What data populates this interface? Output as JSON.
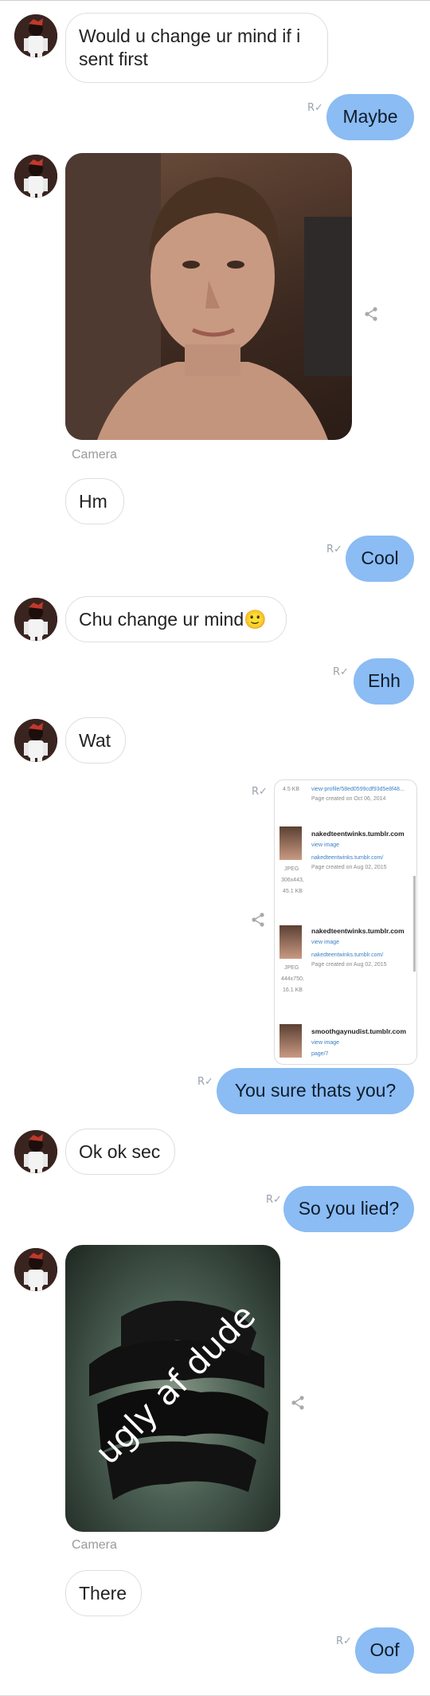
{
  "messages": {
    "m1": "Would u change ur mind if i sent first",
    "m2": "Maybe",
    "photo1_caption": "Camera",
    "m3": "Hm",
    "m4": "Cool",
    "m5": "Chu change ur mind",
    "m5_emoji": "🙂",
    "m6": "Ehh",
    "m7": "Wat",
    "m8": "You sure thats you?",
    "m9": "Ok ok sec",
    "m10": "So you lied?",
    "photo2_caption": "Camera",
    "photo2_overlay": "ugly af dude",
    "m11": "There",
    "m12": "Oof"
  },
  "receipt_icon": "R✓",
  "screenshot": {
    "top_size": "4.5 KB",
    "top_link": "view-profile/58ed0599cdf93d5e8f48...",
    "top_created": "Page created on Oct 06, 2014",
    "r1_site": "nakedteentwinks.tumblr.com",
    "r1_view": "view image",
    "r1_url": "nakedteentwinks.tumblr.com/",
    "r1_created": "Page created on Aug 02, 2015",
    "r1_type": "JPEG",
    "r1_dims": "306x443,",
    "r1_size": "45.1 KB",
    "r2_site": "nakedteentwinks.tumblr.com",
    "r2_view": "view image",
    "r2_url": "nakedteentwinks.tumblr.com/",
    "r2_created": "Page created on Aug 02, 2015",
    "r2_type": "JPEG",
    "r2_dims": "444x750,",
    "r2_size": "16.1 KB",
    "r3_site": "smoothgaynudist.tumblr.com",
    "r3_view": "view image",
    "r3_url": "page/7"
  },
  "icons": {
    "share": "share-icon",
    "receipt": "read-receipt-icon"
  },
  "colors": {
    "outgoing_bubble": "#8bbcf3",
    "incoming_border": "#dedede",
    "caption": "#9a9a9a"
  }
}
